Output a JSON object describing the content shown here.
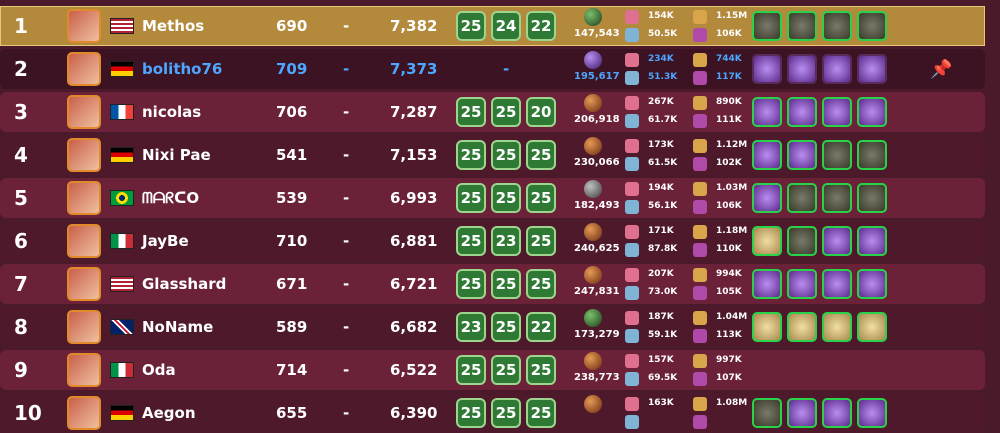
{
  "rows": [
    {
      "rank": "1",
      "name": "Methos",
      "level": "690",
      "dash": "-",
      "points": "7,382",
      "scores": [
        "25",
        "24",
        "22"
      ],
      "power": "147,543",
      "atk": "154K",
      "def": "50.5K",
      "ego": "1.15M",
      "hp": "106K",
      "flag": "usa",
      "orb": "green",
      "cards": [
        "gray",
        "gray",
        "gray",
        "gray"
      ],
      "style": "top"
    },
    {
      "rank": "2",
      "name": "bolitho76",
      "level": "709",
      "dash": "-",
      "points": "7,373",
      "noscore": "-",
      "power": "195,617",
      "atk": "234K",
      "def": "51.3K",
      "ego": "744K",
      "hp": "117K",
      "flag": "germany",
      "orb": "purple",
      "cards": [
        "purple",
        "purple",
        "purple",
        "purple"
      ],
      "style": "self",
      "pin": "pin-icon"
    },
    {
      "rank": "3",
      "name": "nicolas",
      "level": "706",
      "dash": "-",
      "points": "7,287",
      "scores": [
        "25",
        "25",
        "20"
      ],
      "power": "206,918",
      "atk": "267K",
      "def": "61.7K",
      "ego": "890K",
      "hp": "111K",
      "flag": "france",
      "orb": "brown",
      "cards": [
        "purple",
        "purple",
        "purple",
        "purple"
      ],
      "style": "odd"
    },
    {
      "rank": "4",
      "name": "Nixi Pae",
      "level": "541",
      "dash": "-",
      "points": "7,153",
      "scores": [
        "25",
        "25",
        "25"
      ],
      "power": "230,066",
      "atk": "173K",
      "def": "61.5K",
      "ego": "1.12M",
      "hp": "102K",
      "flag": "germany",
      "orb": "brown",
      "cards": [
        "purple",
        "purple",
        "gray",
        "gray"
      ],
      "style": "even"
    },
    {
      "rank": "5",
      "name": "ᗰᗩᖇᑕO",
      "level": "539",
      "dash": "-",
      "points": "6,993",
      "scores": [
        "25",
        "25",
        "25"
      ],
      "power": "182,493",
      "atk": "194K",
      "def": "56.1K",
      "ego": "1.03M",
      "hp": "106K",
      "flag": "brazil",
      "orb": "grey",
      "cards": [
        "purple",
        "gray",
        "gray",
        "gray"
      ],
      "style": "odd"
    },
    {
      "rank": "6",
      "name": "JayBe",
      "level": "710",
      "dash": "-",
      "points": "6,881",
      "scores": [
        "25",
        "23",
        "25"
      ],
      "power": "240,625",
      "atk": "171K",
      "def": "87.8K",
      "ego": "1.18M",
      "hp": "110K",
      "flag": "italy",
      "orb": "brown",
      "cards": [
        "cream",
        "gray",
        "purple",
        "purple"
      ],
      "style": "even"
    },
    {
      "rank": "7",
      "name": "Glasshard",
      "level": "671",
      "dash": "-",
      "points": "6,721",
      "scores": [
        "25",
        "25",
        "25"
      ],
      "power": "247,831",
      "atk": "207K",
      "def": "73.0K",
      "ego": "994K",
      "hp": "105K",
      "flag": "usa",
      "orb": "brown",
      "cards": [
        "purple",
        "purple",
        "purple",
        "purple"
      ],
      "style": "odd"
    },
    {
      "rank": "8",
      "name": "NoName",
      "level": "589",
      "dash": "-",
      "points": "6,682",
      "scores": [
        "23",
        "25",
        "22"
      ],
      "power": "173,279",
      "atk": "187K",
      "def": "59.1K",
      "ego": "1.04M",
      "hp": "113K",
      "flag": "uk",
      "orb": "green",
      "cards": [
        "cream",
        "cream",
        "cream",
        "cream"
      ],
      "style": "even"
    },
    {
      "rank": "9",
      "name": "Oda",
      "level": "714",
      "dash": "-",
      "points": "6,522",
      "scores": [
        "25",
        "25",
        "25"
      ],
      "power": "238,773",
      "atk": "157K",
      "def": "69.5K",
      "ego": "997K",
      "hp": "107K",
      "flag": "italy",
      "orb": "brown",
      "cards": [],
      "style": "odd"
    },
    {
      "rank": "10",
      "name": "Aegon",
      "level": "655",
      "dash": "-",
      "points": "6,390",
      "scores": [
        "25",
        "25",
        "25"
      ],
      "power": "",
      "atk": "163K",
      "def": "",
      "ego": "1.08M",
      "hp": "",
      "flag": "germany",
      "orb": "brown",
      "cards": [
        "gray",
        "purple",
        "purple",
        "purple"
      ],
      "style": "even"
    }
  ]
}
